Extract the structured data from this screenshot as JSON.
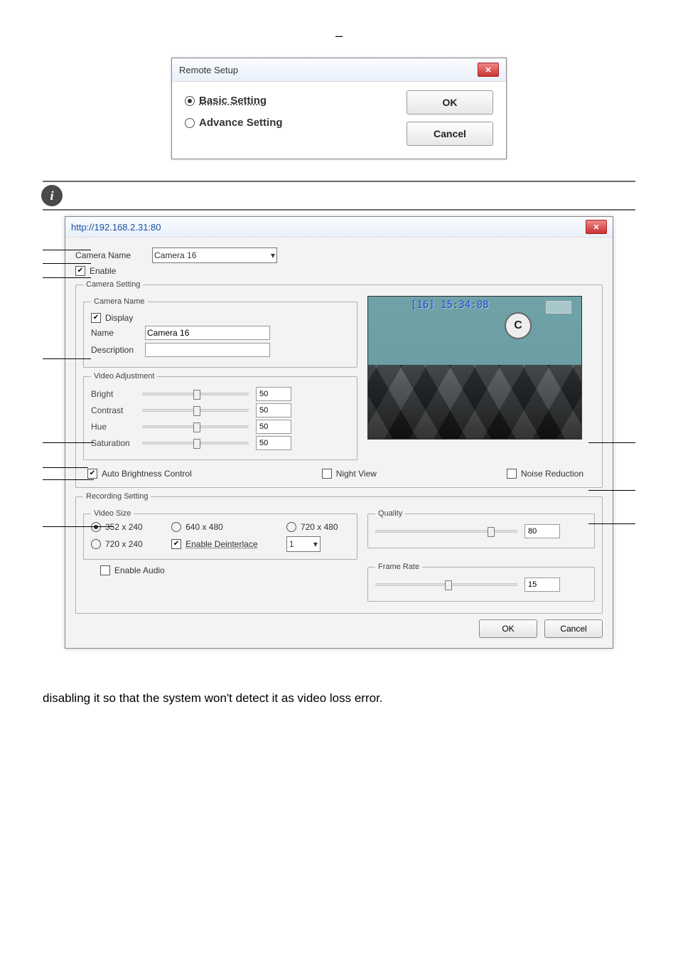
{
  "top_dash": "–",
  "dlg1": {
    "title": "Remote Setup",
    "basic": "Basic Setting",
    "advance": "Advance Setting",
    "ok": "OK",
    "cancel": "Cancel"
  },
  "info_icon_text": "i",
  "dlg2": {
    "title": "http://192.168.2.31:80",
    "camera_name_label": "Camera Name",
    "camera_select": "Camera 16",
    "enable": "Enable",
    "camera_setting_legend": "Camera Setting",
    "camera_name_legend": "Camera Name",
    "display": "Display",
    "name_label": "Name",
    "name_value": "Camera 16",
    "desc_label": "Description",
    "video_adjustment_legend": "Video Adjustment",
    "bright": "Bright",
    "contrast": "Contrast",
    "hue": "Hue",
    "saturation": "Saturation",
    "slider_val": "50",
    "auto_brightness": "Auto Brightness Control",
    "night_view": "Night View",
    "noise_reduction": "Noise Reduction",
    "preview_label": "[16] 15:34:08",
    "preview_c": "C",
    "recording_legend": "Recording Setting",
    "video_size_legend": "Video Size",
    "sizes": [
      "352 x 240",
      "640 x 480",
      "720 x 480",
      "720 x 240"
    ],
    "enable_deinterlace": "Enable Deinterlace",
    "deinterlace_sel": "1",
    "enable_audio": "Enable Audio",
    "quality_legend": "Quality",
    "quality_val": "80",
    "frame_rate_legend": "Frame Rate",
    "frame_rate_val": "15",
    "ok": "OK",
    "cancel": "Cancel"
  },
  "paragraph": "disabling it so that the system won't detect it as video loss error."
}
